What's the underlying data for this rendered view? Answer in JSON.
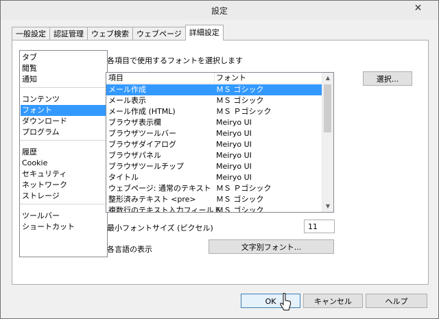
{
  "window": {
    "title": "設定",
    "close_glyph": "✕"
  },
  "tabs": [
    "一般設定",
    "認証管理",
    "ウェブ検索",
    "ウェブページ",
    "詳細設定"
  ],
  "active_tab": 4,
  "side_groups": [
    [
      "タブ",
      "閲覧",
      "通知"
    ],
    [
      "コンテンツ",
      "フォント",
      "ダウンロード",
      "プログラム"
    ],
    [
      "履歴",
      "Cookie",
      "セキュリティ",
      "ネットワーク",
      "ストレージ"
    ],
    [
      "ツールバー",
      "ショートカット"
    ]
  ],
  "side_selected": "フォント",
  "font_section": {
    "heading": "各項目で使用するフォントを選択します",
    "columns": {
      "item": "項目",
      "font": "フォント"
    },
    "rows": [
      {
        "item": "メール作成",
        "font": "ＭＳ ゴシック"
      },
      {
        "item": "メール表示",
        "font": "ＭＳ ゴシック"
      },
      {
        "item": "メール作成 (HTML)",
        "font": "ＭＳ Ｐゴシック"
      },
      {
        "item": "ブラウザ表示欄",
        "font": "Meiryo UI"
      },
      {
        "item": "ブラウザツールバー",
        "font": "Meiryo UI"
      },
      {
        "item": "ブラウザダイアログ",
        "font": "Meiryo UI"
      },
      {
        "item": "ブラウザパネル",
        "font": "Meiryo UI"
      },
      {
        "item": "ブラウザツールチップ",
        "font": "Meiryo UI"
      },
      {
        "item": "タイトル",
        "font": "Meiryo UI"
      },
      {
        "item": "ウェブページ: 通常のテキスト",
        "font": "ＭＳ Ｐゴシック"
      },
      {
        "item": "整形済みテキスト <pre>",
        "font": "ＭＳ ゴシック"
      },
      {
        "item": "複数行のテキスト入力フィールド",
        "font": "ＭＳ ゴシック"
      }
    ],
    "selected_row": 0,
    "select_button": "選択...",
    "min_size_label": "最小フォントサイズ (ピクセル)",
    "min_size_value": "11",
    "lang_label": "各言語の表示",
    "lang_button": "文字別フォント..."
  },
  "footer": {
    "ok": "OK",
    "cancel": "キャンセル",
    "help": "ヘルプ"
  }
}
